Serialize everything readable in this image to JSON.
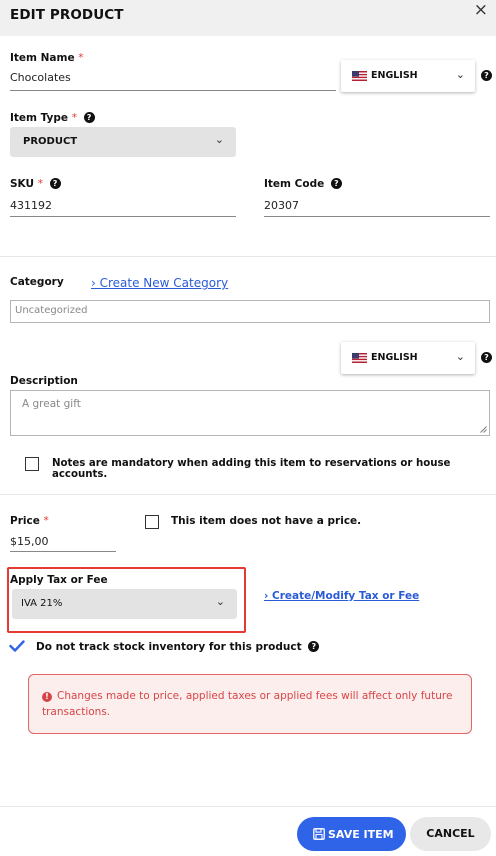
{
  "dialog": {
    "title": "EDIT PRODUCT",
    "close": "×"
  },
  "item_name": {
    "label": "Item Name",
    "required": "*",
    "value": "Chocolates"
  },
  "language_select_1": {
    "value": "ENGLISH"
  },
  "item_type": {
    "label": "Item Type",
    "required": "*",
    "value": "PRODUCT"
  },
  "sku": {
    "label": "SKU",
    "required": "*",
    "value": "431192"
  },
  "item_code": {
    "label": "Item Code",
    "value": "20307"
  },
  "category": {
    "label": "Category",
    "create_link": "› Create New Category",
    "value": "Uncategorized"
  },
  "language_select_2": {
    "value": "ENGLISH"
  },
  "description": {
    "label": "Description",
    "placeholder": "A great gift"
  },
  "notes_checkbox": {
    "label": "Notes are mandatory when adding this item to reservations or house accounts."
  },
  "price": {
    "label": "Price",
    "required": "*",
    "value": "$15,00",
    "no_price_label": "This item does not have a price."
  },
  "tax": {
    "label": "Apply Tax or Fee",
    "value": "IVA 21%",
    "modify_link": "› Create/Modify Tax or Fee"
  },
  "stock": {
    "label": "Do not track stock inventory for this product"
  },
  "notice": {
    "text": "Changes made to price, applied taxes or applied fees will affect only future transactions."
  },
  "actions": {
    "save_label": "SAVE ITEM",
    "cancel_label": "CANCEL"
  },
  "colors": {
    "primary_button": "#2f63e8",
    "link": "#2a5bd7",
    "required": "#e53935",
    "notice_text": "#d64545",
    "highlight_border": "#e53935",
    "check": "#2f63e8"
  }
}
